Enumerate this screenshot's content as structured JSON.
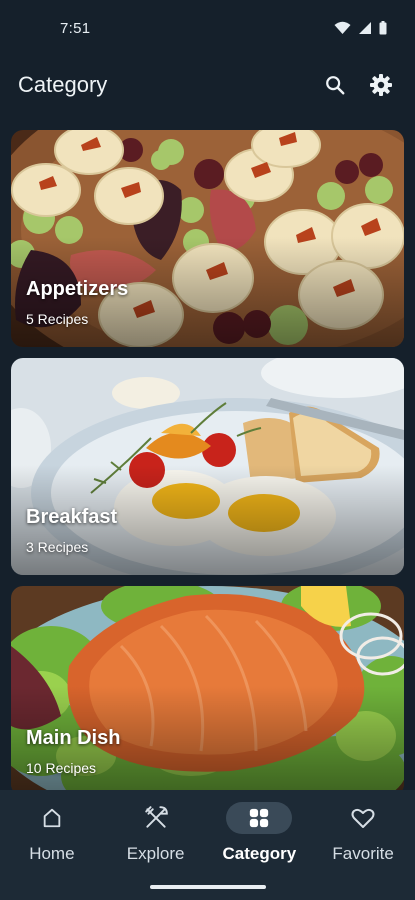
{
  "status_bar": {
    "time": "7:51"
  },
  "app_bar": {
    "title": "Category",
    "actions": [
      {
        "icon": "search-icon"
      },
      {
        "icon": "gear-icon"
      }
    ]
  },
  "categories": [
    {
      "name": "Appetizers",
      "count": "5 Recipes"
    },
    {
      "name": "Breakfast",
      "count": "3 Recipes"
    },
    {
      "name": "Main Dish",
      "count": "10 Recipes"
    }
  ],
  "bottom_nav": {
    "items": [
      {
        "label": "Home",
        "icon": "home-icon",
        "active": false
      },
      {
        "label": "Explore",
        "icon": "fork-knife-icon",
        "active": false
      },
      {
        "label": "Category",
        "icon": "grid-icon",
        "active": true
      },
      {
        "label": "Favorite",
        "icon": "heart-icon",
        "active": false
      }
    ]
  },
  "colors": {
    "background": "#15202b",
    "nav_background": "#1d2a36",
    "active_pill": "#3a4a58",
    "text": "#e8eef3"
  }
}
